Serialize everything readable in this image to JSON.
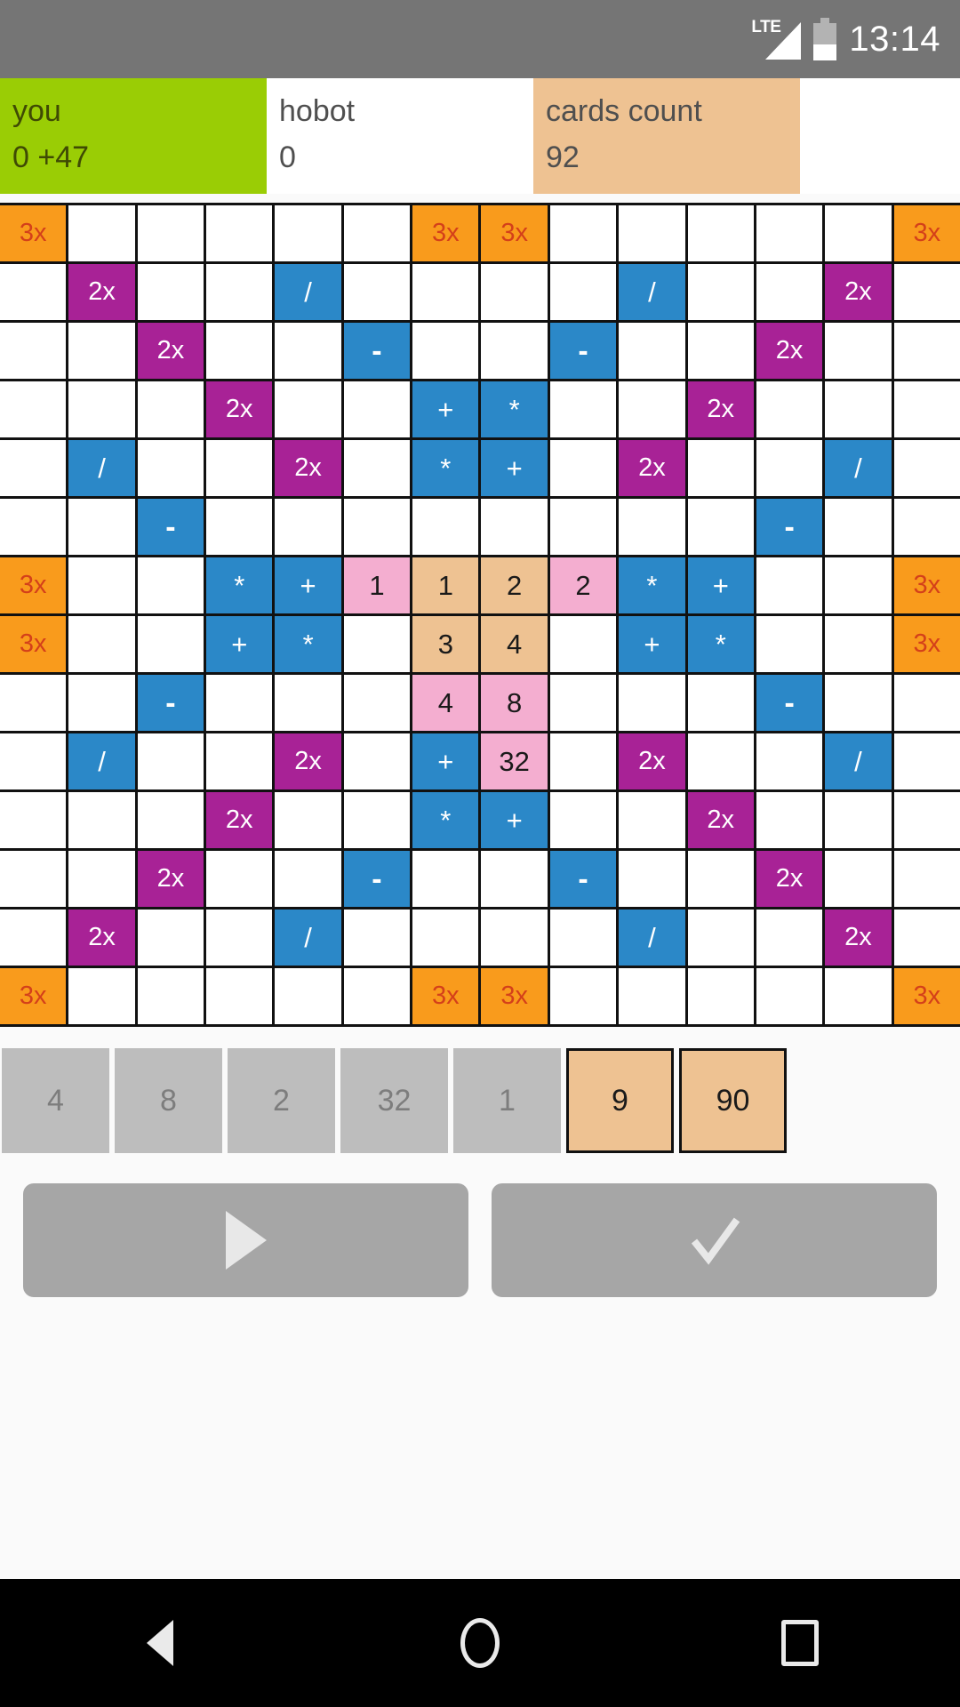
{
  "statusbar": {
    "network_label": "LTE",
    "network_icon": "signal-triangle-icon",
    "battery_icon": "battery-icon",
    "clock": "13:14"
  },
  "scorebar": {
    "you": {
      "label": "you",
      "score": "0",
      "bonus": "+47",
      "display": "0  +47",
      "color": "#9acd05"
    },
    "opponent": {
      "label": "hobot",
      "score": "0",
      "display": "0",
      "color": "#ffffff"
    },
    "cards": {
      "label": "cards count",
      "count": "92",
      "display": "92",
      "color": "#eec292"
    }
  },
  "legend": {
    "x3": "3x",
    "x2": "2x",
    "plus": "+",
    "minus": "-",
    "times": "*",
    "divide": "/"
  },
  "colors": {
    "bonus3x_bg": "#f99b1c",
    "bonus3x_fg": "#d4401a",
    "bonus2x_bg": "#a82296",
    "operator_bg": "#2b88c8",
    "tile_tan": "#eec292",
    "tile_pink": "#f4aed0",
    "board_line": "#111111",
    "used_card": "#bdbdbd"
  },
  "board": {
    "columns": 14,
    "rows": 14,
    "cells": [
      [
        {
          "t": "x3",
          "v": "3x"
        },
        {
          "t": "empty",
          "v": ""
        },
        {
          "t": "empty",
          "v": ""
        },
        {
          "t": "empty",
          "v": ""
        },
        {
          "t": "empty",
          "v": ""
        },
        {
          "t": "empty",
          "v": ""
        },
        {
          "t": "x3",
          "v": "3x"
        },
        {
          "t": "x3",
          "v": "3x"
        },
        {
          "t": "empty",
          "v": ""
        },
        {
          "t": "empty",
          "v": ""
        },
        {
          "t": "empty",
          "v": ""
        },
        {
          "t": "empty",
          "v": ""
        },
        {
          "t": "empty",
          "v": ""
        },
        {
          "t": "x3",
          "v": "3x"
        }
      ],
      [
        {
          "t": "empty",
          "v": ""
        },
        {
          "t": "x2",
          "v": "2x"
        },
        {
          "t": "empty",
          "v": ""
        },
        {
          "t": "empty",
          "v": ""
        },
        {
          "t": "op",
          "v": "/"
        },
        {
          "t": "empty",
          "v": ""
        },
        {
          "t": "empty",
          "v": ""
        },
        {
          "t": "empty",
          "v": ""
        },
        {
          "t": "empty",
          "v": ""
        },
        {
          "t": "op",
          "v": "/"
        },
        {
          "t": "empty",
          "v": ""
        },
        {
          "t": "empty",
          "v": ""
        },
        {
          "t": "x2",
          "v": "2x"
        },
        {
          "t": "empty",
          "v": ""
        }
      ],
      [
        {
          "t": "empty",
          "v": ""
        },
        {
          "t": "empty",
          "v": ""
        },
        {
          "t": "x2",
          "v": "2x"
        },
        {
          "t": "empty",
          "v": ""
        },
        {
          "t": "empty",
          "v": ""
        },
        {
          "t": "op",
          "v": "-"
        },
        {
          "t": "empty",
          "v": ""
        },
        {
          "t": "empty",
          "v": ""
        },
        {
          "t": "op",
          "v": "-"
        },
        {
          "t": "empty",
          "v": ""
        },
        {
          "t": "empty",
          "v": ""
        },
        {
          "t": "x2",
          "v": "2x"
        },
        {
          "t": "empty",
          "v": ""
        },
        {
          "t": "empty",
          "v": ""
        }
      ],
      [
        {
          "t": "empty",
          "v": ""
        },
        {
          "t": "empty",
          "v": ""
        },
        {
          "t": "empty",
          "v": ""
        },
        {
          "t": "x2",
          "v": "2x"
        },
        {
          "t": "empty",
          "v": ""
        },
        {
          "t": "empty",
          "v": ""
        },
        {
          "t": "op",
          "v": "+"
        },
        {
          "t": "op",
          "v": "*"
        },
        {
          "t": "empty",
          "v": ""
        },
        {
          "t": "empty",
          "v": ""
        },
        {
          "t": "x2",
          "v": "2x"
        },
        {
          "t": "empty",
          "v": ""
        },
        {
          "t": "empty",
          "v": ""
        },
        {
          "t": "empty",
          "v": ""
        }
      ],
      [
        {
          "t": "empty",
          "v": ""
        },
        {
          "t": "op",
          "v": "/"
        },
        {
          "t": "empty",
          "v": ""
        },
        {
          "t": "empty",
          "v": ""
        },
        {
          "t": "x2",
          "v": "2x"
        },
        {
          "t": "empty",
          "v": ""
        },
        {
          "t": "op",
          "v": "*"
        },
        {
          "t": "op",
          "v": "+"
        },
        {
          "t": "empty",
          "v": ""
        },
        {
          "t": "x2",
          "v": "2x"
        },
        {
          "t": "empty",
          "v": ""
        },
        {
          "t": "empty",
          "v": ""
        },
        {
          "t": "op",
          "v": "/"
        },
        {
          "t": "empty",
          "v": ""
        }
      ],
      [
        {
          "t": "empty",
          "v": ""
        },
        {
          "t": "empty",
          "v": ""
        },
        {
          "t": "op",
          "v": "-"
        },
        {
          "t": "empty",
          "v": ""
        },
        {
          "t": "empty",
          "v": ""
        },
        {
          "t": "empty",
          "v": ""
        },
        {
          "t": "empty",
          "v": ""
        },
        {
          "t": "empty",
          "v": ""
        },
        {
          "t": "empty",
          "v": ""
        },
        {
          "t": "empty",
          "v": ""
        },
        {
          "t": "empty",
          "v": ""
        },
        {
          "t": "op",
          "v": "-"
        },
        {
          "t": "empty",
          "v": ""
        },
        {
          "t": "empty",
          "v": ""
        }
      ],
      [
        {
          "t": "x3",
          "v": "3x"
        },
        {
          "t": "empty",
          "v": ""
        },
        {
          "t": "empty",
          "v": ""
        },
        {
          "t": "op",
          "v": "*"
        },
        {
          "t": "op",
          "v": "+"
        },
        {
          "t": "pnk",
          "v": "1"
        },
        {
          "t": "tan",
          "v": "1"
        },
        {
          "t": "tan",
          "v": "2"
        },
        {
          "t": "pnk",
          "v": "2"
        },
        {
          "t": "op",
          "v": "*"
        },
        {
          "t": "op",
          "v": "+"
        },
        {
          "t": "empty",
          "v": ""
        },
        {
          "t": "empty",
          "v": ""
        },
        {
          "t": "x3",
          "v": "3x"
        }
      ],
      [
        {
          "t": "x3",
          "v": "3x"
        },
        {
          "t": "empty",
          "v": ""
        },
        {
          "t": "empty",
          "v": ""
        },
        {
          "t": "op",
          "v": "+"
        },
        {
          "t": "op",
          "v": "*"
        },
        {
          "t": "empty",
          "v": ""
        },
        {
          "t": "tan",
          "v": "3"
        },
        {
          "t": "tan",
          "v": "4"
        },
        {
          "t": "empty",
          "v": ""
        },
        {
          "t": "op",
          "v": "+"
        },
        {
          "t": "op",
          "v": "*"
        },
        {
          "t": "empty",
          "v": ""
        },
        {
          "t": "empty",
          "v": ""
        },
        {
          "t": "x3",
          "v": "3x"
        }
      ],
      [
        {
          "t": "empty",
          "v": ""
        },
        {
          "t": "empty",
          "v": ""
        },
        {
          "t": "op",
          "v": "-"
        },
        {
          "t": "empty",
          "v": ""
        },
        {
          "t": "empty",
          "v": ""
        },
        {
          "t": "empty",
          "v": ""
        },
        {
          "t": "pnk",
          "v": "4"
        },
        {
          "t": "pnk",
          "v": "8"
        },
        {
          "t": "empty",
          "v": ""
        },
        {
          "t": "empty",
          "v": ""
        },
        {
          "t": "empty",
          "v": ""
        },
        {
          "t": "op",
          "v": "-"
        },
        {
          "t": "empty",
          "v": ""
        },
        {
          "t": "empty",
          "v": ""
        }
      ],
      [
        {
          "t": "empty",
          "v": ""
        },
        {
          "t": "op",
          "v": "/"
        },
        {
          "t": "empty",
          "v": ""
        },
        {
          "t": "empty",
          "v": ""
        },
        {
          "t": "x2",
          "v": "2x"
        },
        {
          "t": "empty",
          "v": ""
        },
        {
          "t": "op",
          "v": "+"
        },
        {
          "t": "pnk",
          "v": "32"
        },
        {
          "t": "empty",
          "v": ""
        },
        {
          "t": "x2",
          "v": "2x"
        },
        {
          "t": "empty",
          "v": ""
        },
        {
          "t": "empty",
          "v": ""
        },
        {
          "t": "op",
          "v": "/"
        },
        {
          "t": "empty",
          "v": ""
        }
      ],
      [
        {
          "t": "empty",
          "v": ""
        },
        {
          "t": "empty",
          "v": ""
        },
        {
          "t": "empty",
          "v": ""
        },
        {
          "t": "x2",
          "v": "2x"
        },
        {
          "t": "empty",
          "v": ""
        },
        {
          "t": "empty",
          "v": ""
        },
        {
          "t": "op",
          "v": "*"
        },
        {
          "t": "op",
          "v": "+"
        },
        {
          "t": "empty",
          "v": ""
        },
        {
          "t": "empty",
          "v": ""
        },
        {
          "t": "x2",
          "v": "2x"
        },
        {
          "t": "empty",
          "v": ""
        },
        {
          "t": "empty",
          "v": ""
        },
        {
          "t": "empty",
          "v": ""
        }
      ],
      [
        {
          "t": "empty",
          "v": ""
        },
        {
          "t": "empty",
          "v": ""
        },
        {
          "t": "x2",
          "v": "2x"
        },
        {
          "t": "empty",
          "v": ""
        },
        {
          "t": "empty",
          "v": ""
        },
        {
          "t": "op",
          "v": "-"
        },
        {
          "t": "empty",
          "v": ""
        },
        {
          "t": "empty",
          "v": ""
        },
        {
          "t": "op",
          "v": "-"
        },
        {
          "t": "empty",
          "v": ""
        },
        {
          "t": "empty",
          "v": ""
        },
        {
          "t": "x2",
          "v": "2x"
        },
        {
          "t": "empty",
          "v": ""
        },
        {
          "t": "empty",
          "v": ""
        }
      ],
      [
        {
          "t": "empty",
          "v": ""
        },
        {
          "t": "x2",
          "v": "2x"
        },
        {
          "t": "empty",
          "v": ""
        },
        {
          "t": "empty",
          "v": ""
        },
        {
          "t": "op",
          "v": "/"
        },
        {
          "t": "empty",
          "v": ""
        },
        {
          "t": "empty",
          "v": ""
        },
        {
          "t": "empty",
          "v": ""
        },
        {
          "t": "empty",
          "v": ""
        },
        {
          "t": "op",
          "v": "/"
        },
        {
          "t": "empty",
          "v": ""
        },
        {
          "t": "empty",
          "v": ""
        },
        {
          "t": "x2",
          "v": "2x"
        },
        {
          "t": "empty",
          "v": ""
        }
      ],
      [
        {
          "t": "x3",
          "v": "3x"
        },
        {
          "t": "empty",
          "v": ""
        },
        {
          "t": "empty",
          "v": ""
        },
        {
          "t": "empty",
          "v": ""
        },
        {
          "t": "empty",
          "v": ""
        },
        {
          "t": "empty",
          "v": ""
        },
        {
          "t": "x3",
          "v": "3x"
        },
        {
          "t": "x3",
          "v": "3x"
        },
        {
          "t": "empty",
          "v": ""
        },
        {
          "t": "empty",
          "v": ""
        },
        {
          "t": "empty",
          "v": ""
        },
        {
          "t": "empty",
          "v": ""
        },
        {
          "t": "empty",
          "v": ""
        },
        {
          "t": "x3",
          "v": "3x"
        }
      ]
    ]
  },
  "hand": {
    "cards": [
      {
        "value": "4",
        "state": "used"
      },
      {
        "value": "8",
        "state": "used"
      },
      {
        "value": "2",
        "state": "used"
      },
      {
        "value": "32",
        "state": "used"
      },
      {
        "value": "1",
        "state": "used"
      },
      {
        "value": "9",
        "state": "available"
      },
      {
        "value": "90",
        "state": "available"
      }
    ]
  },
  "actions": {
    "play": {
      "icon": "play-triangle-icon",
      "label": ""
    },
    "confirm": {
      "icon": "check-icon",
      "label": ""
    }
  },
  "navbar": {
    "back": "back-triangle-icon",
    "home": "home-circle-icon",
    "recents": "recents-square-icon"
  }
}
